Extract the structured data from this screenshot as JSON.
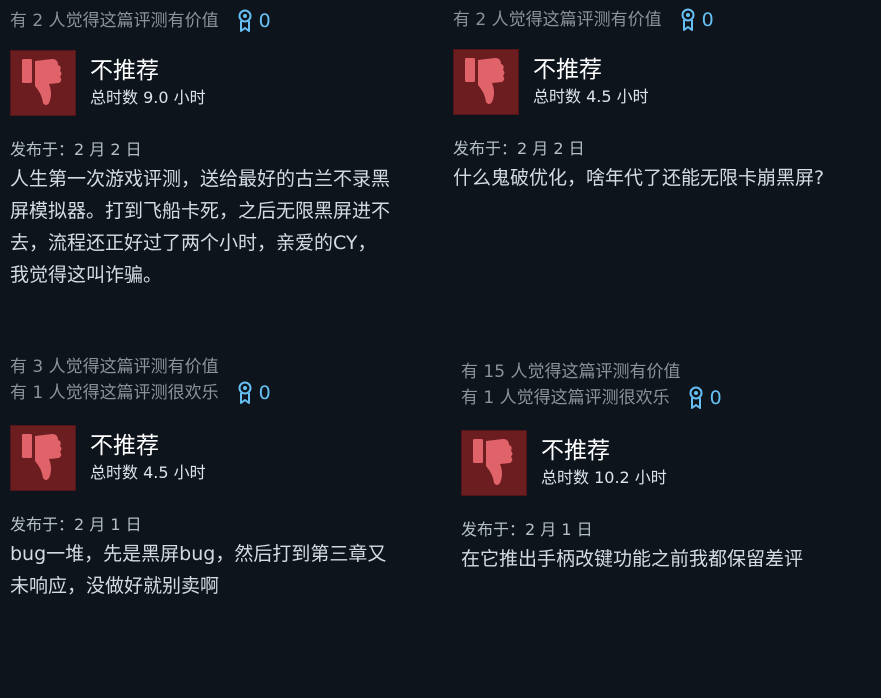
{
  "reviews": [
    {
      "helpful_lines": [
        "有 2 人觉得这篇评测有价值"
      ],
      "award_count": "0",
      "verdict": "不推荐",
      "hours": "总时数 9.0 小时",
      "posted": "发布于：2 月 2 日",
      "body_lines": [
        "人生第一次游戏评测，送给最好的古兰不录黑",
        "屏模拟器。打到飞船卡死，之后无限黑屏进不",
        "去，流程还正好过了两个小时，亲爱的CY，",
        "我觉得这叫诈骗。"
      ]
    },
    {
      "helpful_lines": [
        "有 2 人觉得这篇评测有价值"
      ],
      "award_count": "0",
      "verdict": "不推荐",
      "hours": "总时数 4.5 小时",
      "posted": "发布于：2 月 2 日",
      "body_lines": [
        "什么鬼破优化，啥年代了还能无限卡崩黑屏?"
      ]
    },
    {
      "helpful_lines": [
        "有 3 人觉得这篇评测有价值",
        "有 1 人觉得这篇评测很欢乐"
      ],
      "award_count": "0",
      "verdict": "不推荐",
      "hours": "总时数 4.5 小时",
      "posted": "发布于：2 月 1 日",
      "body_lines": [
        "bug一堆，先是黑屏bug，然后打到第三章又",
        "未响应，没做好就别卖啊"
      ]
    },
    {
      "helpful_lines": [
        "有 15 人觉得这篇评测有价值",
        "有 1 人觉得这篇评测很欢乐"
      ],
      "award_count": "0",
      "verdict": "不推荐",
      "hours": "总时数 10.2 小时",
      "posted": "发布于：2 月 1 日",
      "body_lines": [
        "在它推出手柄改键功能之前我都保留差评"
      ]
    }
  ],
  "colors": {
    "award": "#66c0f4",
    "thumb_bg": "#6b1d20",
    "thumb_icon": "#e0636a"
  },
  "icons": {
    "verdict": "thumbs-down-icon",
    "award": "award-ribbon-icon"
  }
}
